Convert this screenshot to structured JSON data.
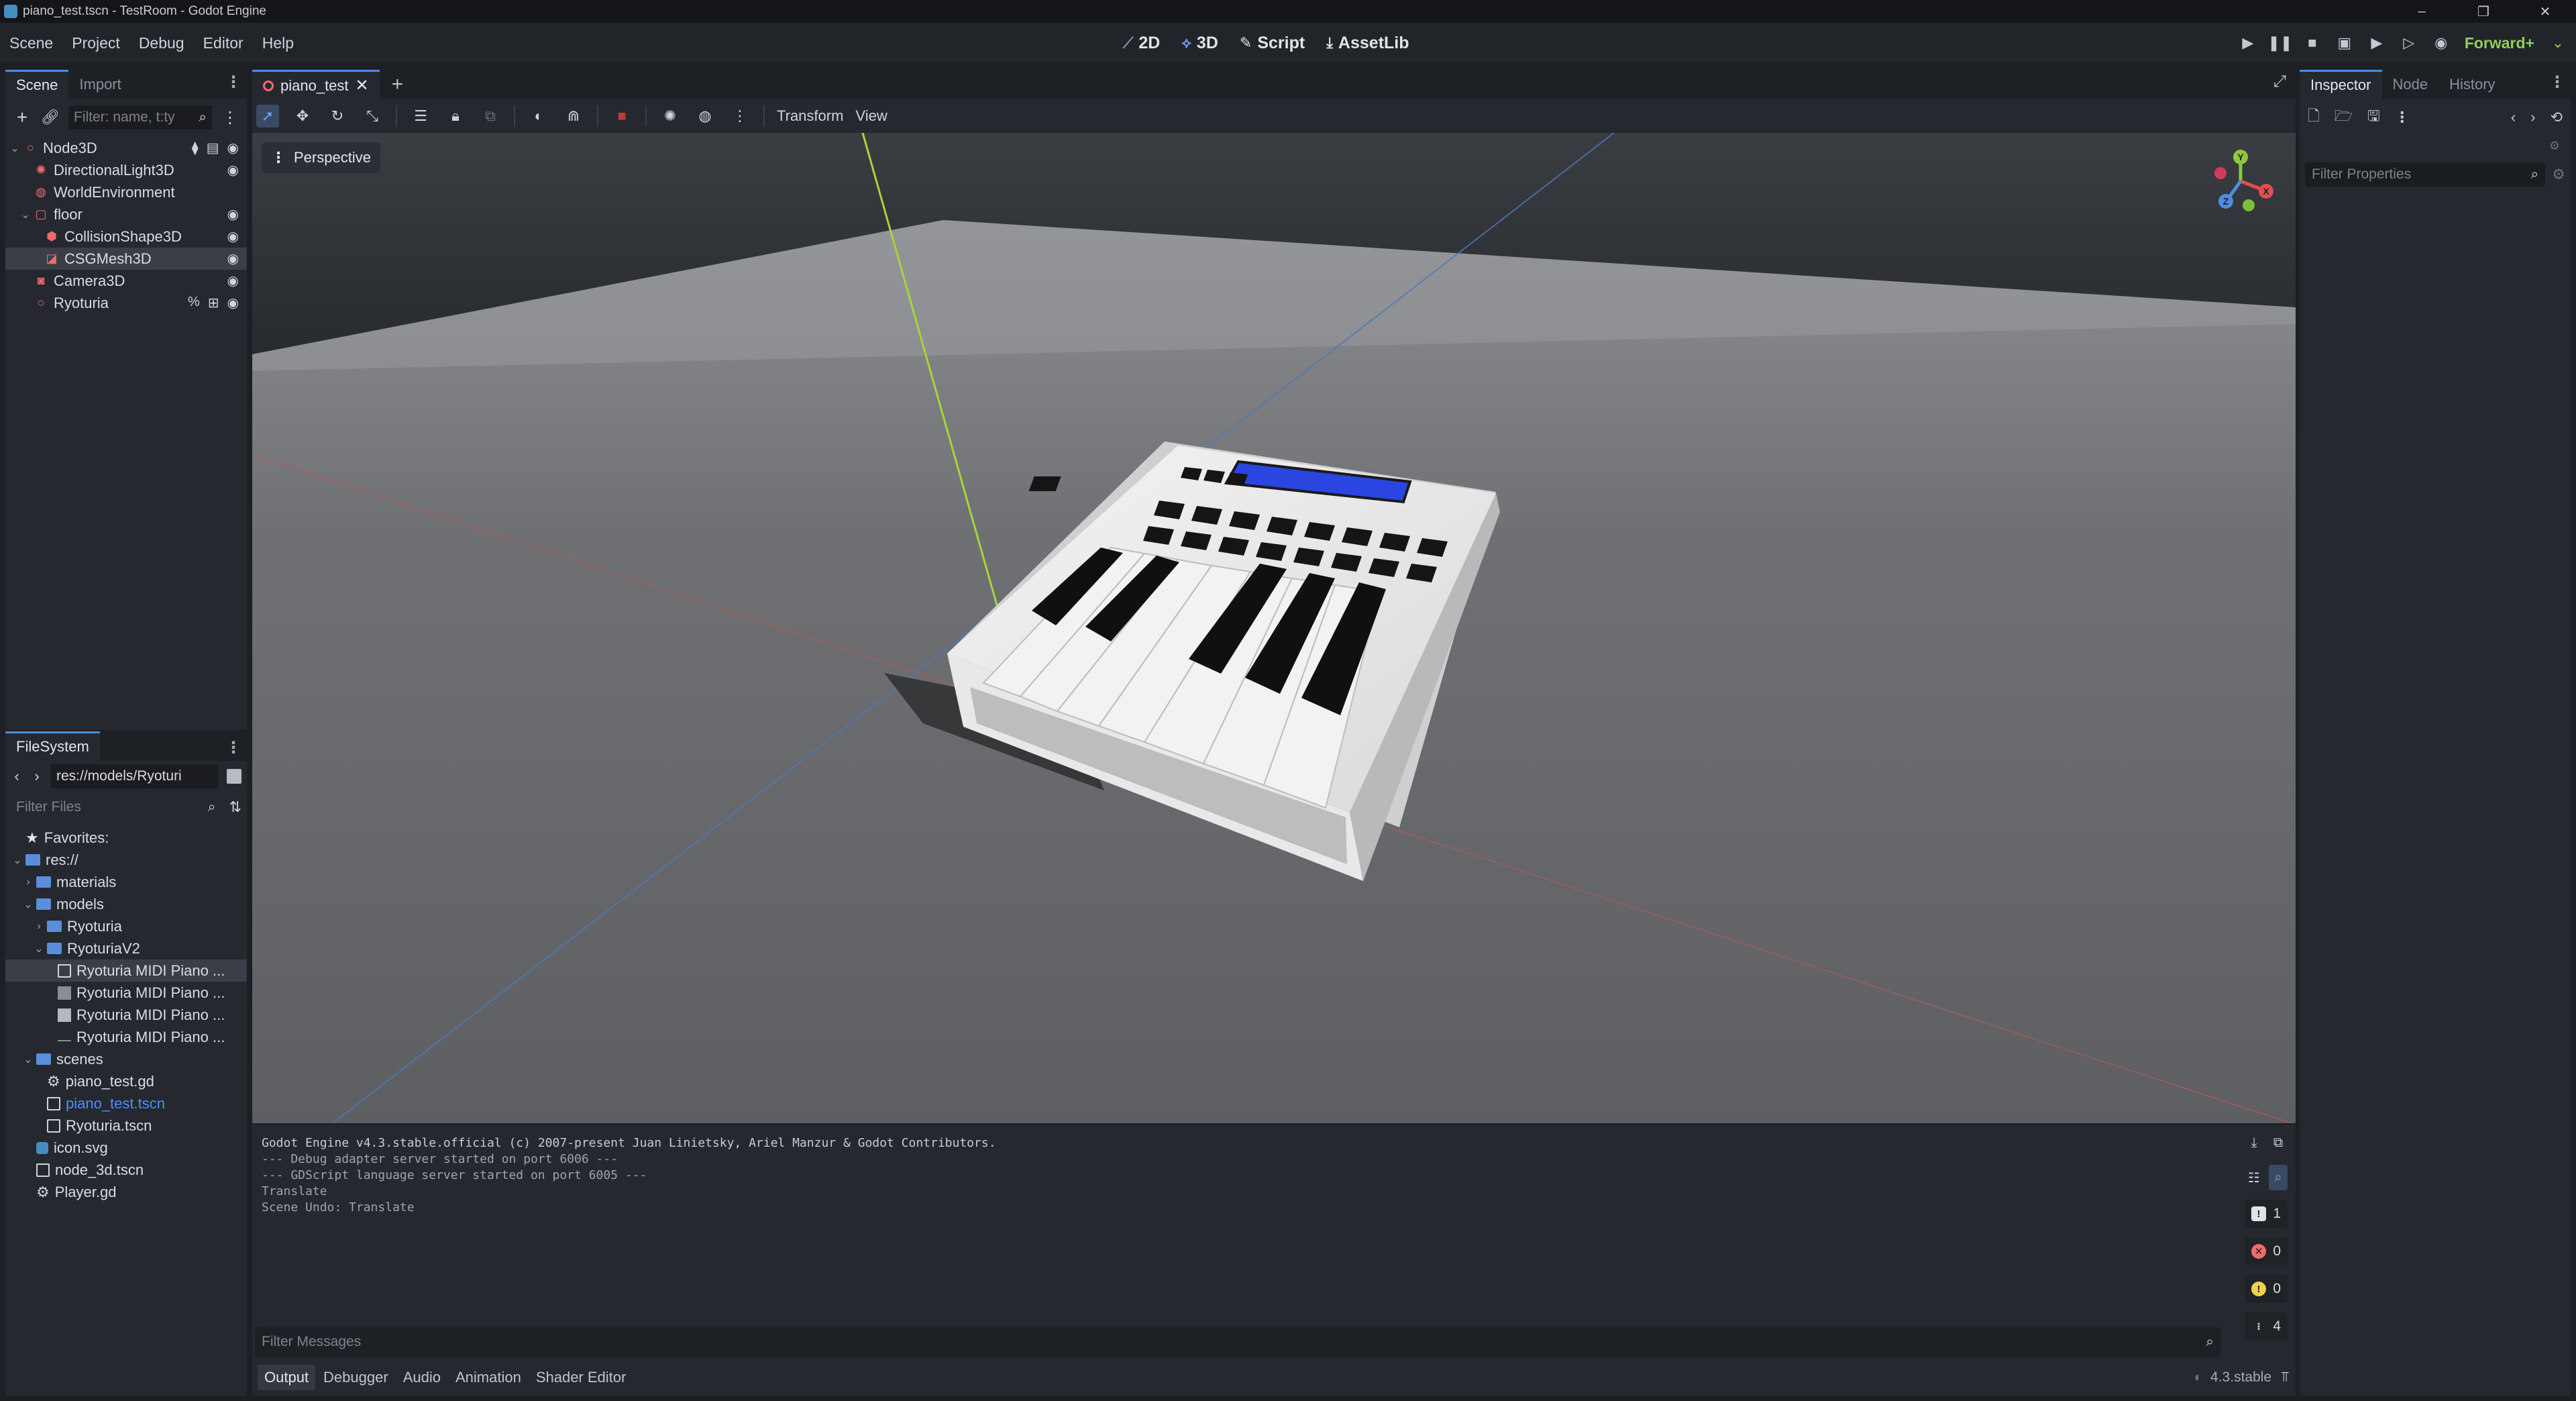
{
  "window": {
    "title": "piano_test.tscn - TestRoom - Godot Engine",
    "controls": [
      "–",
      "❐",
      "✕"
    ]
  },
  "menu": [
    "Scene",
    "Project",
    "Debug",
    "Editor",
    "Help"
  ],
  "workspaces": [
    {
      "label": "2D",
      "icon": "2d-icon"
    },
    {
      "label": "3D",
      "icon": "3d-icon",
      "active": true
    },
    {
      "label": "Script",
      "icon": "script-icon"
    },
    {
      "label": "AssetLib",
      "icon": "assetlib-icon"
    }
  ],
  "renderer": "Forward+",
  "scene_dock": {
    "tabs": [
      "Scene",
      "Import"
    ],
    "filter_placeholder": "Filter: name, t:ty",
    "tree": [
      {
        "label": "Node3D",
        "icon": "node3d-icon",
        "depth": 0,
        "arrow": "⌄",
        "right": [
          "signal-icon",
          "script-icon",
          "visibility-icon"
        ]
      },
      {
        "label": "DirectionalLight3D",
        "icon": "light-icon",
        "depth": 1,
        "right": [
          "visibility-icon"
        ]
      },
      {
        "label": "WorldEnvironment",
        "icon": "environment-icon",
        "depth": 1,
        "right": []
      },
      {
        "label": "floor",
        "icon": "staticbody-icon",
        "depth": 1,
        "arrow": "⌄",
        "right": [
          "visibility-icon"
        ]
      },
      {
        "label": "CollisionShape3D",
        "icon": "collision-icon",
        "depth": 2,
        "right": [
          "visibility-icon"
        ]
      },
      {
        "label": "CSGMesh3D",
        "icon": "csg-icon",
        "depth": 2,
        "right": [
          "visibility-icon"
        ],
        "selected": true
      },
      {
        "label": "Camera3D",
        "icon": "camera-icon",
        "depth": 1,
        "right": [
          "visibility-icon"
        ]
      },
      {
        "label": "Ryoturia",
        "icon": "node3d-icon",
        "depth": 1,
        "right": [
          "editable-icon",
          "instance-icon",
          "visibility-icon"
        ]
      }
    ]
  },
  "filesystem": {
    "tab": "FileSystem",
    "path": "res://models/Ryoturi",
    "filter_placeholder": "Filter Files",
    "items": [
      {
        "label": "Favorites:",
        "type": "favorites",
        "depth": 0
      },
      {
        "label": "res://",
        "type": "folder",
        "depth": 0,
        "arrow": "⌄"
      },
      {
        "label": "materials",
        "type": "folder",
        "depth": 1,
        "arrow": "›"
      },
      {
        "label": "models",
        "type": "folder",
        "depth": 1,
        "arrow": "⌄"
      },
      {
        "label": "Ryoturia",
        "type": "folder",
        "depth": 2,
        "arrow": "›"
      },
      {
        "label": "RyoturiaV2",
        "type": "folder",
        "depth": 2,
        "arrow": "⌄"
      },
      {
        "label": "Ryoturia MIDI Piano ...",
        "type": "scene",
        "depth": 3,
        "selected": true
      },
      {
        "label": "Ryoturia MIDI Piano ...",
        "type": "image",
        "depth": 3
      },
      {
        "label": "Ryoturia MIDI Piano ...",
        "type": "image2",
        "depth": 3
      },
      {
        "label": "Ryoturia MIDI Piano ...",
        "type": "bin",
        "depth": 3
      },
      {
        "label": "scenes",
        "type": "folder",
        "depth": 1,
        "arrow": "⌄"
      },
      {
        "label": "piano_test.gd",
        "type": "gear",
        "depth": 2
      },
      {
        "label": "piano_test.tscn",
        "type": "scene",
        "depth": 2,
        "highlight": true
      },
      {
        "label": "Ryoturia.tscn",
        "type": "scene",
        "depth": 2
      },
      {
        "label": "icon.svg",
        "type": "svg",
        "depth": 1
      },
      {
        "label": "node_3d.tscn",
        "type": "scene",
        "depth": 1
      },
      {
        "label": "Player.gd",
        "type": "gear",
        "depth": 1
      }
    ]
  },
  "editor_tabs": [
    {
      "label": "piano_test",
      "active": true
    }
  ],
  "viewport_toolbar": {
    "labels": [
      "Transform",
      "View"
    ]
  },
  "viewport": {
    "mode_label": "Perspective",
    "gizmo": {
      "x": "X",
      "y": "Y",
      "z": "Z"
    }
  },
  "output": {
    "lines": [
      "Godot Engine v4.3.stable.official (c) 2007-present Juan Linietsky, Ariel Manzur & Godot Contributors.",
      "--- Debug adapter server started on port 6006 ---",
      "--- GDScript language server started on port 6005 ---",
      "Translate",
      "Scene Undo: Translate"
    ],
    "counts": [
      {
        "icon": "message-icon",
        "value": "1",
        "color": "#e0e3e8"
      },
      {
        "icon": "error-icon",
        "value": "0",
        "color": "#f26a6a"
      },
      {
        "icon": "warning-icon",
        "value": "0",
        "color": "#f2d24b"
      },
      {
        "icon": "editor-message-icon",
        "value": "4",
        "color": "#c8ccd2"
      }
    ],
    "filter_placeholder": "Filter Messages",
    "bottom_tabs": [
      "Output",
      "Debugger",
      "Audio",
      "Animation",
      "Shader Editor"
    ],
    "version": "4.3.stable"
  },
  "inspector": {
    "tabs": [
      "Inspector",
      "Node",
      "History"
    ],
    "filter_placeholder": "Filter Properties"
  }
}
